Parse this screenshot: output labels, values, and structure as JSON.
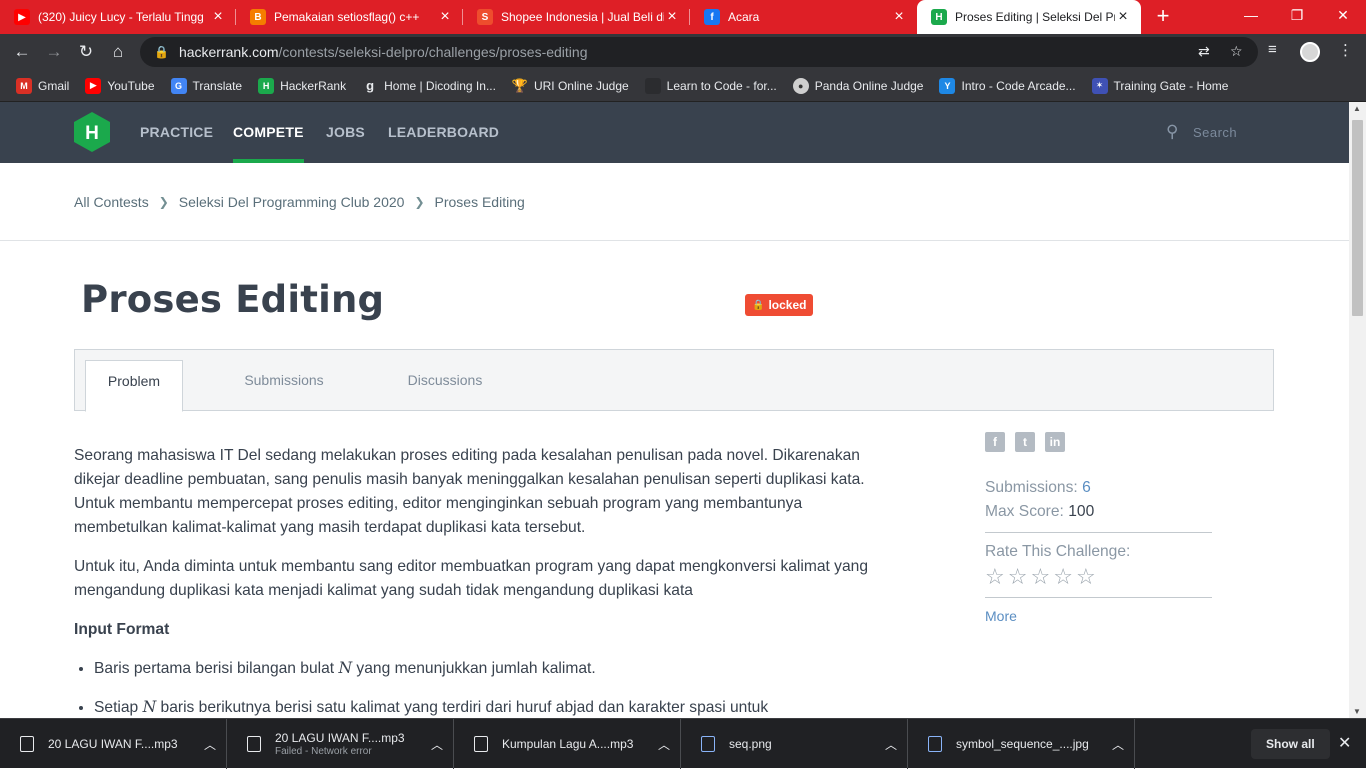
{
  "browser": {
    "tabs": [
      {
        "title": "(320) Juicy Lucy - Terlalu Tingg",
        "favicon": "youtube-icon"
      },
      {
        "title": "Pemakaian setiosflag() c++",
        "favicon": "blogger-icon"
      },
      {
        "title": "Shopee Indonesia | Jual Beli di",
        "favicon": "shopee-icon"
      },
      {
        "title": "Acara",
        "favicon": "facebook-icon"
      },
      {
        "title": "Proses Editing | Seleksi Del Pro",
        "favicon": "hackerrank-icon",
        "active": true
      }
    ],
    "url_host": "hackerrank.com",
    "url_path": "/contests/seleksi-delpro/challenges/proses-editing",
    "bookmarks": [
      {
        "label": "Gmail",
        "icon": "gmail-icon",
        "color": "#d93025"
      },
      {
        "label": "YouTube",
        "icon": "youtube-icon",
        "color": "#ff0000"
      },
      {
        "label": "Translate",
        "icon": "translate-icon",
        "color": "#4285f4"
      },
      {
        "label": "HackerRank",
        "icon": "hackerrank-icon",
        "color": "#1ba94c"
      },
      {
        "label": "Home | Dicoding In...",
        "icon": "dicoding-icon",
        "color": "#35363a"
      },
      {
        "label": "URI Online Judge",
        "icon": "trophy-icon",
        "color": "#c89b2e"
      },
      {
        "label": "Learn to Code - for...",
        "icon": "freecodecamp-icon",
        "color": "#2b2c2f"
      },
      {
        "label": "Panda Online Judge",
        "icon": "panda-icon",
        "color": "#555"
      },
      {
        "label": "Intro - Code Arcade...",
        "icon": "codesignal-icon",
        "color": "#1e88e5"
      },
      {
        "label": "Training Gate - Home",
        "icon": "training-gate-icon",
        "color": "#3f51b5"
      }
    ]
  },
  "hr_nav": {
    "links": [
      "PRACTICE",
      "COMPETE",
      "JOBS",
      "LEADERBOARD"
    ],
    "active": "COMPETE",
    "search_placeholder": "Search"
  },
  "breadcrumb": [
    "All Contests",
    "Seleksi Del Programming Club 2020",
    "Proses Editing"
  ],
  "challenge": {
    "title": "Proses Editing",
    "badge": "locked",
    "tabs": [
      "Problem",
      "Submissions",
      "Discussions"
    ],
    "paragraph1": "Seorang mahasiswa IT Del sedang melakukan proses editing pada kesalahan penulisan pada novel. Dikarenakan dikejar deadline pembuatan, sang penulis masih banyak meninggalkan kesalahan penulisan seperti duplikasi kata. Untuk membantu mempercepat proses editing, editor menginginkan sebuah program yang membantunya membetulkan kalimat-kalimat yang masih terdapat duplikasi kata tersebut.",
    "paragraph2": "Untuk itu, Anda diminta untuk membantu sang editor membuatkan program yang dapat mengkonversi kalimat yang mengandung duplikasi kata menjadi kalimat yang sudah tidak mengandung duplikasi kata",
    "input_format_heading": "Input Format",
    "bullet1_pre": "Baris pertama berisi bilangan bulat ",
    "bullet1_var": "N",
    "bullet1_post": " yang menunjukkan jumlah kalimat.",
    "bullet2_pre": "Setiap ",
    "bullet2_var": "N",
    "bullet2_post": " baris berikutnya berisi satu kalimat yang terdiri dari huruf abjad dan karakter spasi untuk"
  },
  "sidebar": {
    "submissions_label": "Submissions:",
    "submissions_value": "6",
    "max_score_label": "Max Score:",
    "max_score_value": "100",
    "rate_label": "Rate This Challenge:",
    "rating": 0,
    "more": "More"
  },
  "downloads": [
    {
      "name": "20 LAGU IWAN F....mp3",
      "status": ""
    },
    {
      "name": "20 LAGU IWAN F....mp3",
      "status": "Failed - Network error"
    },
    {
      "name": "Kumpulan Lagu A....mp3",
      "status": ""
    },
    {
      "name": "seq.png",
      "status": ""
    },
    {
      "name": "symbol_sequence_....jpg",
      "status": ""
    }
  ],
  "show_all": "Show all",
  "colors": {
    "hr_green": "#1ba94c",
    "hr_nav": "#39424e",
    "chrome_red": "#de1f26",
    "locked": "#ef4c33"
  }
}
